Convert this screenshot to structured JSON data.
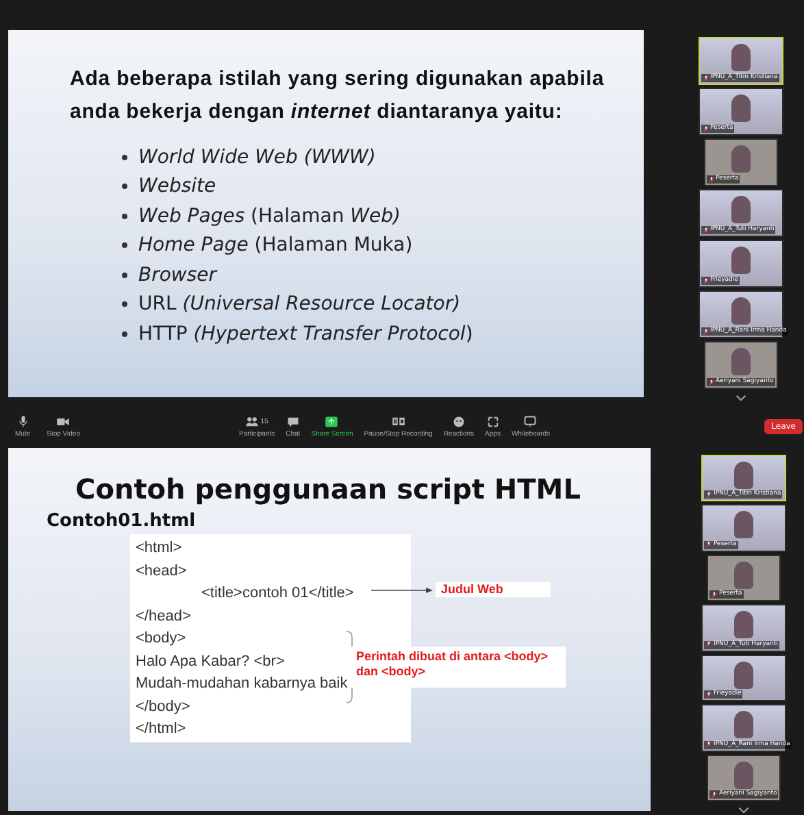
{
  "top_screen": {
    "slide": {
      "heading": "Ada beberapa istilah yang sering digunakan apabila anda bekerja dengan *internet* diantaranya yaitu:",
      "items": [
        "*World Wide Web (WWW)*",
        "*Website*",
        "*Web Pages* (Halaman *Web)*",
        "*Home Page* (Halaman Muka)",
        "*Browser*",
        "URL *(Universal Resource Locator)*",
        "HTTP *(Hypertext Transfer Protocol*)"
      ]
    },
    "participants": [
      {
        "name": "IPNU_A_Titin Kristiana",
        "speaking": true,
        "kind": "wide"
      },
      {
        "name": "Peserta",
        "speaking": false,
        "kind": "wide"
      },
      {
        "name": "Peserta",
        "speaking": false,
        "kind": "narrow"
      },
      {
        "name": "IPNU_A_Tuti Haryanti",
        "speaking": false,
        "kind": "wide"
      },
      {
        "name": "Frieyadie",
        "speaking": false,
        "kind": "wide"
      },
      {
        "name": "IPNU_A_Rani Irma Handa",
        "speaking": false,
        "kind": "wide"
      },
      {
        "name": "Aeriyani Sagiyanto",
        "speaking": false,
        "kind": "narrow"
      }
    ]
  },
  "toolbar": {
    "left": [
      {
        "label": "Mute"
      },
      {
        "label": "Stop Video"
      }
    ],
    "center": [
      {
        "label": "Participants",
        "count": "15"
      },
      {
        "label": "Chat"
      },
      {
        "label": "Share Screen"
      },
      {
        "label": "Pause/Stop Recording"
      },
      {
        "label": "Reactions"
      },
      {
        "label": "Apps"
      },
      {
        "label": "Whiteboards"
      }
    ],
    "leave": "Leave"
  },
  "bottom_screen": {
    "slide": {
      "title": "Contoh penggunaan script HTML",
      "filename": "Contoh01.html",
      "code": [
        {
          "text": "<html>",
          "indented": false
        },
        {
          "text": "<head>",
          "indented": false
        },
        {
          "text": "<title>contoh 01</title>",
          "indented": true
        },
        {
          "text": "</head>",
          "indented": false
        },
        {
          "text": "<body>",
          "indented": false
        },
        {
          "text": "Halo Apa Kabar? <br>",
          "indented": false
        },
        {
          "text": "Mudah-mudahan kabarnya baik",
          "indented": false
        },
        {
          "text": "</body>",
          "indented": false
        },
        {
          "text": "</html>",
          "indented": false
        }
      ],
      "title_note": "Judul Web",
      "body_note": "Perintah dibuat di antara <body> dan <body>"
    },
    "participants": [
      {
        "name": "IPNU_A_Titin Kristiana",
        "speaking": true,
        "kind": "wide"
      },
      {
        "name": "Peserta",
        "speaking": false,
        "kind": "wide"
      },
      {
        "name": "Peserta",
        "speaking": false,
        "kind": "narrow"
      },
      {
        "name": "IPNU_A_Tuti Haryanti",
        "speaking": false,
        "kind": "wide"
      },
      {
        "name": "Frieyadie",
        "speaking": false,
        "kind": "wide"
      },
      {
        "name": "IPNU_A_Rani Irma Handa",
        "speaking": false,
        "kind": "wide"
      },
      {
        "name": "Aeriyani Sagiyanto",
        "speaking": false,
        "kind": "narrow"
      }
    ]
  }
}
